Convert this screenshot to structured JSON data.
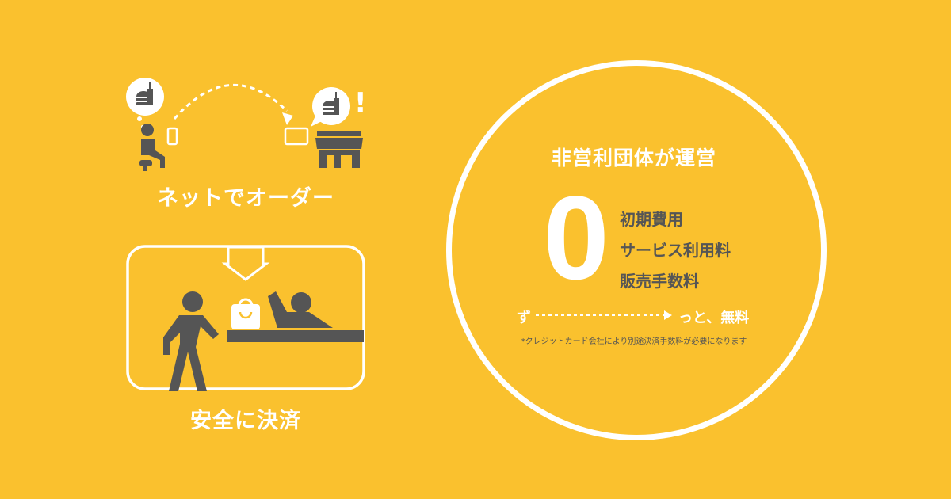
{
  "left": {
    "online_label": "ネットでオーダー",
    "payment_label": "安全に決済",
    "exclaim": "!"
  },
  "right": {
    "org_label": "非営利団体が運営",
    "zero": "0",
    "fees": [
      "初期費用",
      "サービス利用料",
      "販売手数料"
    ],
    "zu": "ず",
    "free": "っと、無料",
    "note": "*クレジットカード会社により別途決済手数料が必要になります"
  },
  "colors": {
    "background": "#FAC12E",
    "white": "#FFFFFF",
    "dark": "#555555"
  }
}
